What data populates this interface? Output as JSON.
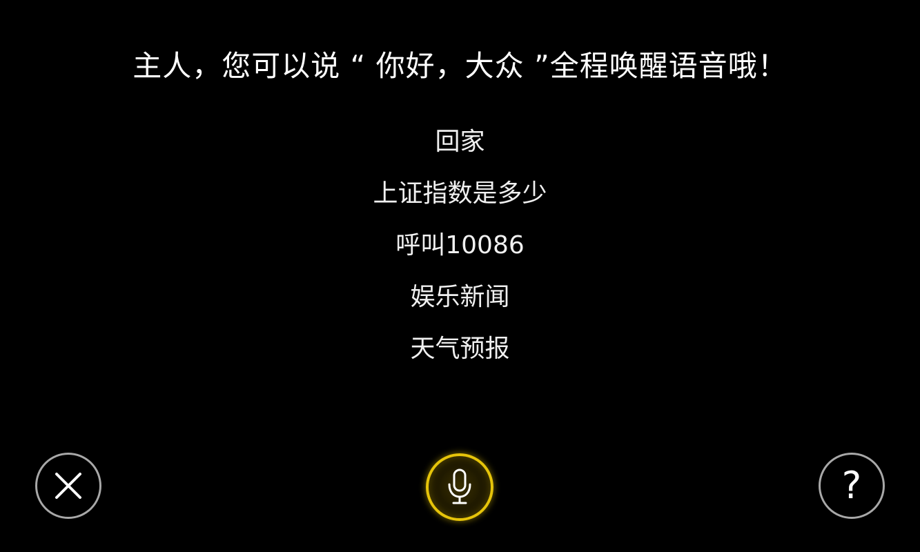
{
  "prompt": {
    "text": "主人，您可以说 “ 你好，大众 ”全程唤醒语音哦！"
  },
  "suggestions": [
    {
      "label": "回家"
    },
    {
      "label": "上证指数是多少"
    },
    {
      "label": "呼叫10086"
    },
    {
      "label": "娱乐新闻"
    },
    {
      "label": "天气预报"
    }
  ],
  "controls": {
    "close": {
      "icon": "close-icon"
    },
    "mic": {
      "icon": "microphone-icon",
      "accent": "#e6c40a"
    },
    "help": {
      "icon": "question-mark-icon",
      "glyph": "?"
    }
  },
  "colors": {
    "background": "#000000",
    "text": "#ffffff",
    "button_border": "#a8a8a8",
    "mic_accent": "#e6c40a"
  }
}
